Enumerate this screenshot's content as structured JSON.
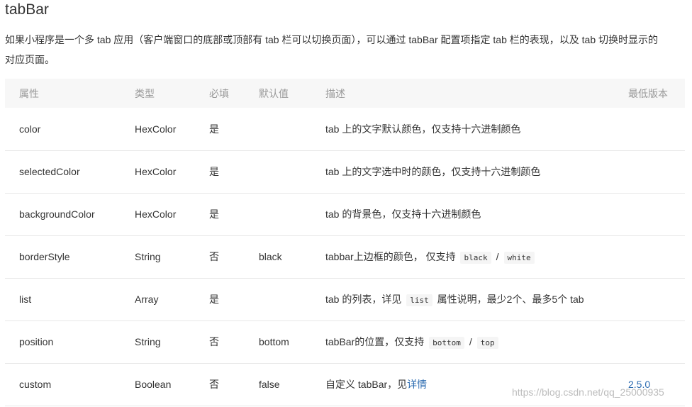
{
  "title": "tabBar",
  "intro": {
    "line1": "如果小程序是一个多 tab 应用（客户端窗口的底部或顶部有 tab 栏可以切换页面），可以通过 tabBar 配置项指定 tab 栏的表现，以及 tab 切换时显示的",
    "line2": "对应页面。"
  },
  "table": {
    "headers": [
      "属性",
      "类型",
      "必填",
      "默认值",
      "描述",
      "最低版本"
    ],
    "rows": [
      {
        "name": "color",
        "type": "HexColor",
        "required": "是",
        "default": "",
        "desc": "tab 上的文字默认颜色，仅支持十六进制颜色",
        "version": ""
      },
      {
        "name": "selectedColor",
        "type": "HexColor",
        "required": "是",
        "default": "",
        "desc": "tab 上的文字选中时的颜色，仅支持十六进制颜色",
        "version": ""
      },
      {
        "name": "backgroundColor",
        "type": "HexColor",
        "required": "是",
        "default": "",
        "desc": "tab 的背景色，仅支持十六进制颜色",
        "version": ""
      },
      {
        "name": "borderStyle",
        "type": "String",
        "required": "否",
        "default": "black",
        "desc_pre": "tabbar上边框的颜色， 仅支持",
        "code1": "black",
        "sep": "/",
        "code2": "white",
        "version": ""
      },
      {
        "name": "list",
        "type": "Array",
        "required": "是",
        "default": "",
        "desc_pre": "tab 的列表，详见",
        "code1": "list",
        "desc_post": "属性说明，最少2个、最多5个 tab",
        "version": ""
      },
      {
        "name": "position",
        "type": "String",
        "required": "否",
        "default": "bottom",
        "desc_pre": "tabBar的位置，仅支持",
        "code1": "bottom",
        "sep": "/",
        "code2": "top",
        "version": ""
      },
      {
        "name": "custom",
        "type": "Boolean",
        "required": "否",
        "default": "false",
        "desc_pre": "自定义 tabBar，见",
        "link": "详情",
        "version": "2.5.0"
      }
    ]
  },
  "watermark": "https://blog.csdn.net/qq_25000935",
  "colors": {
    "link": "#2b6bb0",
    "header_bg": "#f7f7f7",
    "header_text": "#999999"
  }
}
